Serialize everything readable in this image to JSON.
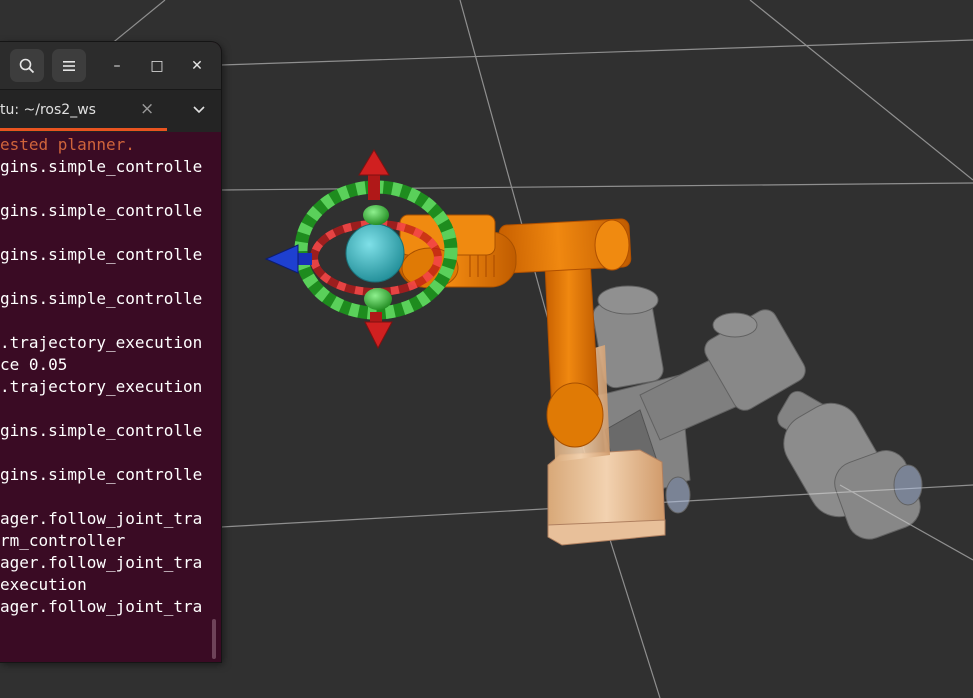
{
  "window": {
    "search_icon": "search-icon",
    "menu_icon": "hamburger-menu-icon",
    "minimize_glyph": "–",
    "maximize_glyph": "□",
    "close_glyph": "✕"
  },
  "tab": {
    "label": "tu: ~/ros2_ws",
    "close_glyph": "×",
    "dropdown_icon": "chevron-down-icon",
    "accent_color": "#e95420"
  },
  "terminal": {
    "background": "#3a0b24",
    "lines": [
      {
        "text": "ested planner.",
        "style": "warn"
      },
      {
        "text": "gins.simple_controlle",
        "style": "normal"
      },
      {
        "text": "",
        "style": "normal"
      },
      {
        "text": "gins.simple_controlle",
        "style": "normal"
      },
      {
        "text": "",
        "style": "normal"
      },
      {
        "text": "gins.simple_controlle",
        "style": "normal"
      },
      {
        "text": "",
        "style": "normal"
      },
      {
        "text": "gins.simple_controlle",
        "style": "normal"
      },
      {
        "text": "",
        "style": "normal"
      },
      {
        "text": ".trajectory_execution",
        "style": "normal"
      },
      {
        "text": "ce 0.05",
        "style": "normal"
      },
      {
        "text": ".trajectory_execution",
        "style": "normal"
      },
      {
        "text": "",
        "style": "normal"
      },
      {
        "text": "gins.simple_controlle",
        "style": "normal"
      },
      {
        "text": "",
        "style": "normal"
      },
      {
        "text": "gins.simple_controlle",
        "style": "normal"
      },
      {
        "text": "",
        "style": "normal"
      },
      {
        "text": "ager.follow_joint_tra",
        "style": "normal"
      },
      {
        "text": "rm_controller",
        "style": "normal"
      },
      {
        "text": "ager.follow_joint_tra",
        "style": "normal"
      },
      {
        "text": "execution",
        "style": "normal"
      },
      {
        "text": "ager.follow_joint_tra",
        "style": "normal"
      }
    ]
  },
  "scene": {
    "background": "#303030",
    "grid_color": "#a0a0a0",
    "robot_color": "#e87a05",
    "base_color": "#e9c39d",
    "ghost_robot_color": "#c8c8c8",
    "marker_ring_color": "#28a528",
    "marker_sphere_color": "#2aa8b0",
    "arrow_x_color": "#b01818",
    "arrow_y_color": "#1830b8",
    "arrow_z_color": "#30a830"
  }
}
